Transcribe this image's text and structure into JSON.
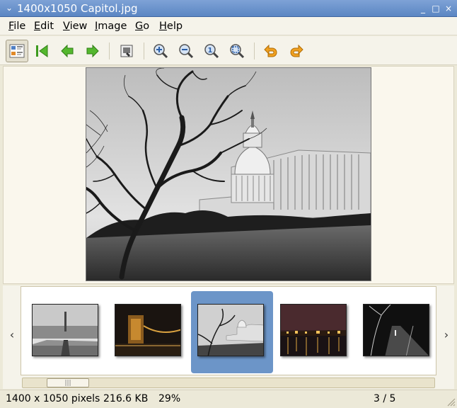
{
  "window": {
    "title": "1400x1050 Capitol.jpg",
    "menu_glyph": "⌄",
    "minimize": "_",
    "maximize": "□",
    "close": "×"
  },
  "menubar": {
    "items": [
      {
        "mnemonic": "F",
        "rest": "ile"
      },
      {
        "mnemonic": "E",
        "rest": "dit"
      },
      {
        "mnemonic": "V",
        "rest": "iew"
      },
      {
        "mnemonic": "I",
        "rest": "mage"
      },
      {
        "mnemonic": "G",
        "rest": "o"
      },
      {
        "mnemonic": "H",
        "rest": "elp"
      }
    ]
  },
  "toolbar": {
    "icons": [
      "thumbnails-toggle-icon",
      "first-image-icon",
      "previous-image-icon",
      "next-image-icon",
      "fullscreen-icon",
      "zoom-in-icon",
      "zoom-out-icon",
      "zoom-normal-icon",
      "zoom-fit-icon",
      "rotate-left-icon",
      "rotate-right-icon"
    ],
    "colors": {
      "green": "#3c9a1e",
      "blue": "#4f7fc5",
      "orange": "#f0a020"
    },
    "zoom_normal_glyph": "1"
  },
  "strip": {
    "prev_arrow": "‹",
    "next_arrow": "›",
    "selected_index": 2,
    "thumbnails": [
      {
        "name": "thumb-city-view"
      },
      {
        "name": "thumb-chain-bridge-night"
      },
      {
        "name": "thumb-capitol"
      },
      {
        "name": "thumb-riverside-night"
      },
      {
        "name": "thumb-park-night"
      }
    ],
    "scroll_grip": "|||",
    "scroll_position": 0.06
  },
  "status": {
    "dimensions": "1400 x 1050 pixels",
    "size": "216.6 KB",
    "zoom": "29%",
    "position": "3 / 5"
  }
}
